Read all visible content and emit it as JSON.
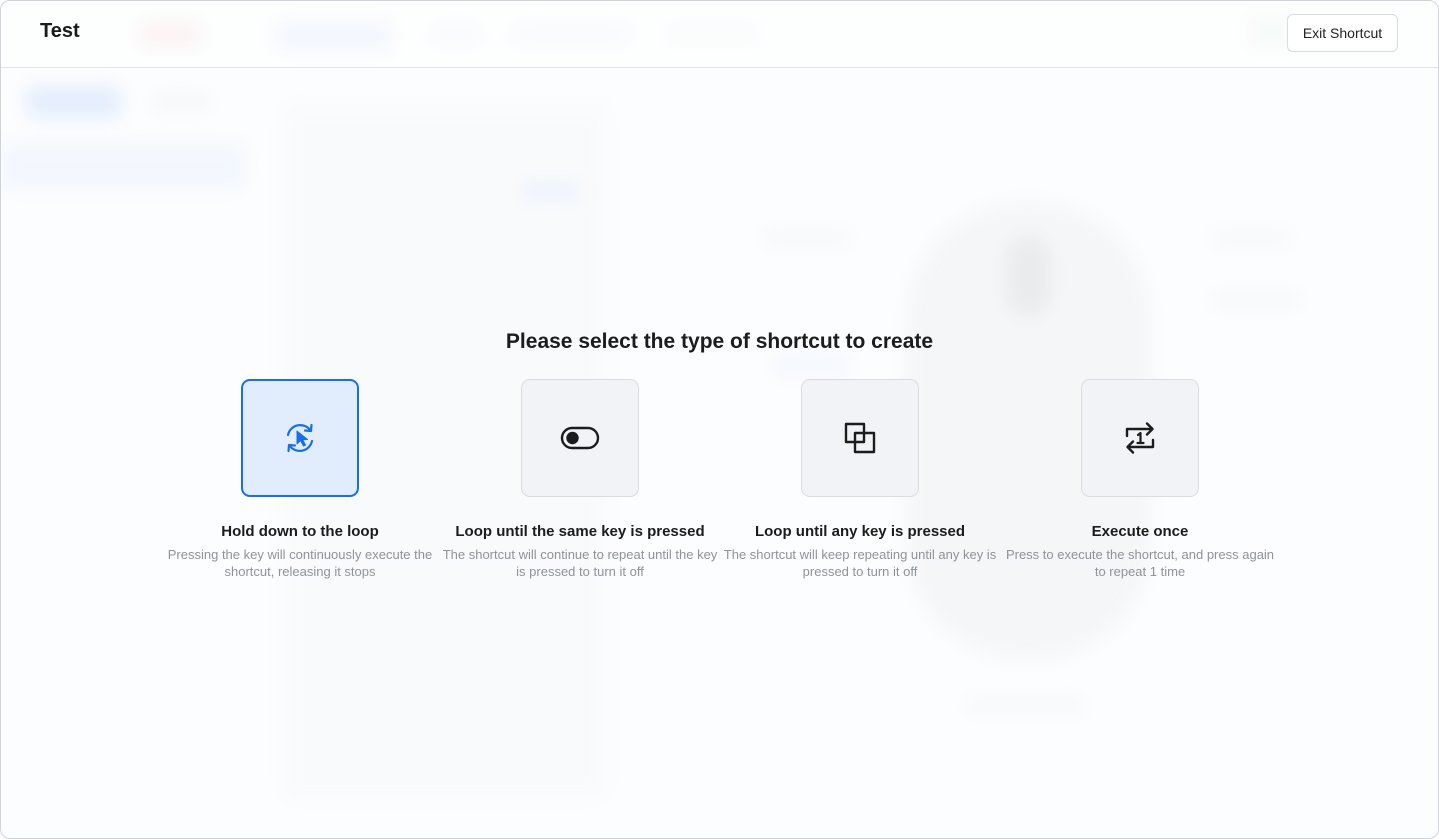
{
  "header": {
    "title": "Test",
    "exit_label": "Exit Shortcut"
  },
  "dialog": {
    "prompt": "Please select the type of shortcut to create",
    "selected_index": 0,
    "options": [
      {
        "label": "Hold down to the loop",
        "description": "Pressing the key will continuously execute the shortcut, releasing it stops",
        "icon": "hold-loop-icon"
      },
      {
        "label": "Loop until the same key is pressed",
        "description": "The shortcut will continue to repeat until the key is pressed to turn it off",
        "icon": "toggle-icon"
      },
      {
        "label": "Loop until any key is pressed",
        "description": "The shortcut will keep repeating until any key is pressed to turn it off",
        "icon": "overlap-squares-icon"
      },
      {
        "label": "Execute once",
        "description": "Press to execute the shortcut, and press again to repeat 1 time",
        "icon": "repeat-once-icon"
      }
    ]
  },
  "colors": {
    "accent": "#1a6fe8",
    "selected_bg": "#e1ecfc",
    "card_bg": "#f1f3f7",
    "text": "#1c1c1c",
    "muted": "#8e939b"
  }
}
